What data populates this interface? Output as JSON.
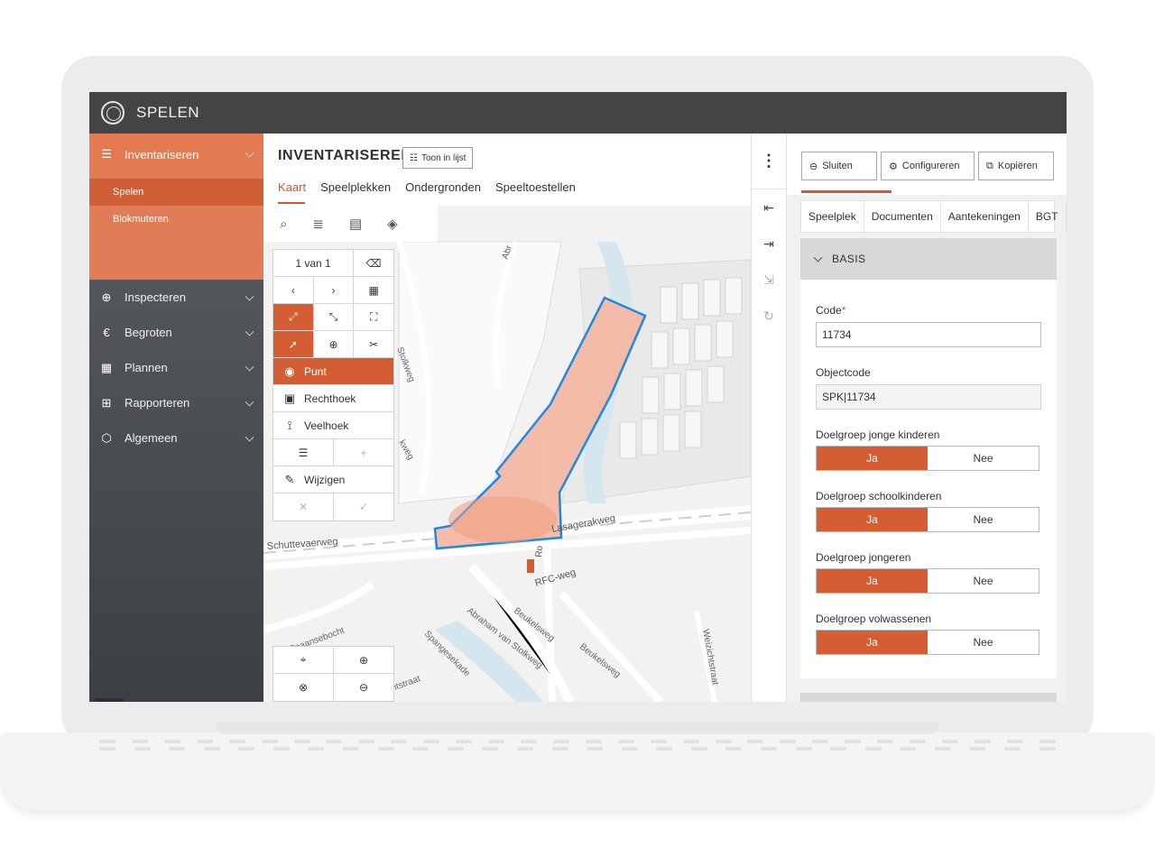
{
  "app": {
    "title": "SPELEN"
  },
  "sidebar": {
    "active": {
      "label": "Inventariseren",
      "icon": "list-icon"
    },
    "sub_items": [
      {
        "label": "Spelen",
        "selected": true
      },
      {
        "label": "Blokmuteren",
        "selected": false
      }
    ],
    "items": [
      {
        "label": "Inspecteren",
        "icon": "magnifier-plus-icon"
      },
      {
        "label": "Begroten",
        "icon": "euro-icon"
      },
      {
        "label": "Plannen",
        "icon": "calendar-icon"
      },
      {
        "label": "Rapporteren",
        "icon": "table-icon"
      },
      {
        "label": "Algemeen",
        "icon": "cube-icon"
      }
    ]
  },
  "main": {
    "title": "INVENTARISEREN",
    "list_button": "Toon in lijst",
    "tabs": [
      "Kaart",
      "Speelplekken",
      "Ondergronden",
      "Speeltoestellen"
    ],
    "active_tab": "Kaart"
  },
  "map": {
    "counter": "1 van 1",
    "draw_items": {
      "punt": "Punt",
      "rechthoek": "Rechthoek",
      "veelhoek": "Veelhoek",
      "wijzigen": "Wijzigen"
    },
    "streets": {
      "schuttevaerweg": "Schuttevaerweg",
      "lasagerakweg": "Lasagerakweg",
      "rfc_weg": "RFC-weg",
      "spaansebocht": "Spaansebocht",
      "spangesekade": "Spangesekade",
      "abraham": "Abraham van Stolkweg",
      "beukelsweg1": "Beukelsweg",
      "beukelsweg2": "Beukelsweg",
      "weizichtstraat": "Weizichtstraat",
      "stolkweg": "Stolkweg",
      "abr": "Abr",
      "kweg": "kweg",
      "ro": "Ro",
      "ntstraat": "ntstraat"
    },
    "colors": {
      "accent": "#d55d34",
      "polygon_stroke": "#1e88e5",
      "polygon_fill": "#f4b6a0"
    }
  },
  "detail": {
    "actions": {
      "close": "Sluiten",
      "configure": "Configureren",
      "copy": "Kopiëren"
    },
    "tabs": [
      "Speelplek",
      "Documenten",
      "Aantekeningen",
      "BGT"
    ],
    "section": "BASIS",
    "fields": {
      "code_label": "Code",
      "code_required": "*",
      "code_value": "11734",
      "objectcode_label": "Objectcode",
      "objectcode_value": "SPK|11734"
    },
    "toggles": [
      {
        "label": "Doelgroep jonge kinderen",
        "yes": "Ja",
        "no": "Nee",
        "value": "Ja"
      },
      {
        "label": "Doelgroep schoolkinderen",
        "yes": "Ja",
        "no": "Nee",
        "value": "Ja"
      },
      {
        "label": "Doelgroep jongeren",
        "yes": "Ja",
        "no": "Nee",
        "value": "Ja"
      },
      {
        "label": "Doelgroep volwassenen",
        "yes": "Ja",
        "no": "Nee",
        "value": "Ja"
      }
    ]
  }
}
